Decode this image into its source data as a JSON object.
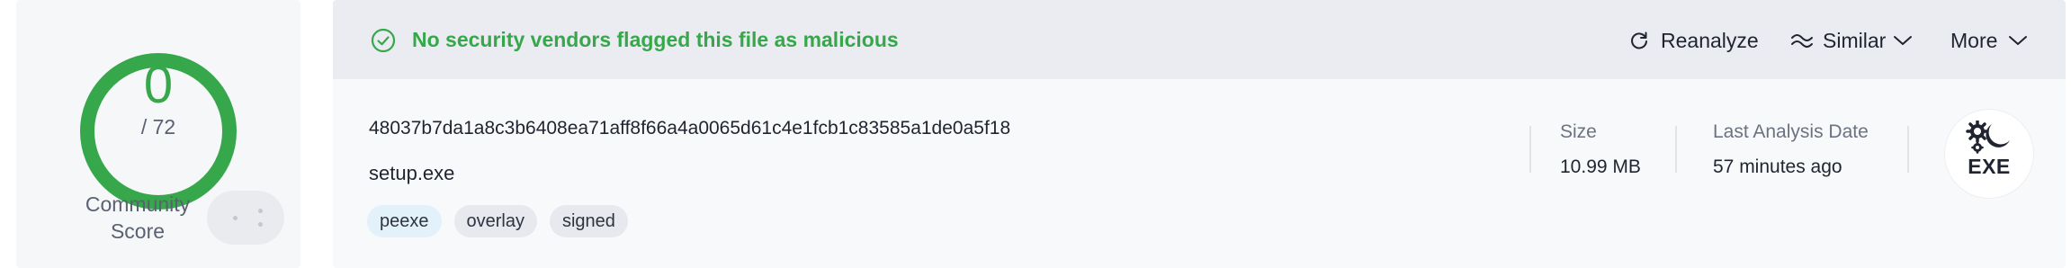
{
  "detection": {
    "score": "0",
    "total": "/ 72",
    "ring_color": "#36a84b",
    "community_label": "Community\nScore"
  },
  "verdict": {
    "icon": "check-circle-icon",
    "text": "No security vendors flagged this file as malicious",
    "color": "#36a84b"
  },
  "actions": {
    "reanalyze": {
      "label": "Reanalyze",
      "icon": "refresh-icon"
    },
    "similar": {
      "label": "Similar",
      "icon": "similar-icon",
      "chevron": "chevron-down-icon"
    },
    "more": {
      "label": "More",
      "chevron": "chevron-down-icon"
    }
  },
  "file": {
    "hash": "48037b7da1a8c3b6408ea71aff8f66a4a0065d61c4e1fcb1c83585a1de0a5f18",
    "name": "setup.exe",
    "tags": [
      "peexe",
      "overlay",
      "signed"
    ],
    "size_label": "Size",
    "size_value": "10.99 MB",
    "date_label": "Last Analysis Date",
    "date_value": "57 minutes ago",
    "type_icon": "exe-file-icon",
    "type_label": "EXE"
  }
}
